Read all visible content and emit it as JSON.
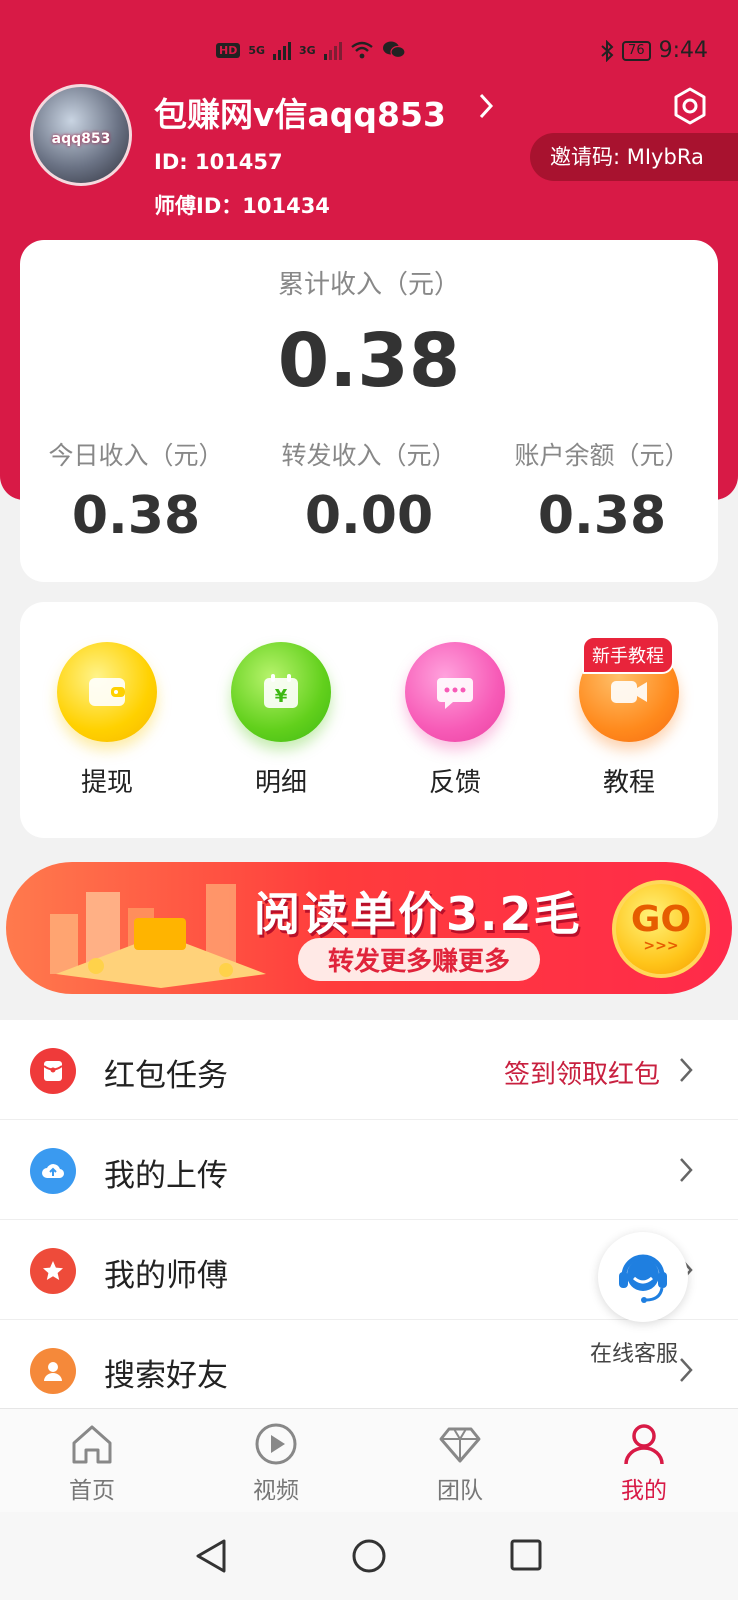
{
  "status_bar": {
    "time": "9:44",
    "battery": "76",
    "network_1": "5G",
    "network_2": "3G",
    "hd": "HD"
  },
  "profile": {
    "avatar_text": "aqq853",
    "name": "包赚网v信aqq853",
    "id_text": "ID: 101457",
    "master_id_text": "师傅ID：101434",
    "invite_code_text": "邀请码: MIybRa"
  },
  "earnings": {
    "total_label": "累计收入（元）",
    "total_value": "0.38",
    "stats": [
      {
        "label": "今日收入（元）",
        "value": "0.38"
      },
      {
        "label": "转发收入（元）",
        "value": "0.00"
      },
      {
        "label": "账户余额（元）",
        "value": "0.38"
      }
    ]
  },
  "actions": [
    {
      "label": "提现",
      "icon": "wallet-icon",
      "color": "#ffd100"
    },
    {
      "label": "明细",
      "icon": "calendar-yuan-icon",
      "color": "#62d01c"
    },
    {
      "label": "反馈",
      "icon": "chat-bubble-icon",
      "color": "#f75bb7"
    },
    {
      "label": "教程",
      "icon": "video-camera-icon",
      "color": "#ff8a1d"
    }
  ],
  "tutorial_badge": "新手教程",
  "banner": {
    "title": "阅读单价3.2毛",
    "subtitle": "转发更多赚更多",
    "go_text": "GO",
    "go_arrows": ">>>"
  },
  "menu": [
    {
      "label": "红包任务",
      "extra": "签到领取红包",
      "icon": "red-envelope-icon",
      "color": "#ef3a3a"
    },
    {
      "label": "我的上传",
      "extra": "",
      "icon": "cloud-upload-icon",
      "color": "#3a9af0"
    },
    {
      "label": "我的师傅",
      "extra": "",
      "icon": "star-icon",
      "color": "#ee4b3a"
    },
    {
      "label": "搜索好友",
      "extra": "",
      "icon": "person-icon",
      "color": "#f5893a"
    }
  ],
  "customer_service": {
    "label": "在线客服"
  },
  "tabs": [
    {
      "label": "首页",
      "icon": "home-icon",
      "active": false
    },
    {
      "label": "视频",
      "icon": "play-icon",
      "active": false
    },
    {
      "label": "团队",
      "icon": "diamond-icon",
      "active": false
    },
    {
      "label": "我的",
      "icon": "user-icon",
      "active": true
    }
  ],
  "colors": {
    "brand": "#d81a46",
    "accent_text": "#c8203f"
  }
}
